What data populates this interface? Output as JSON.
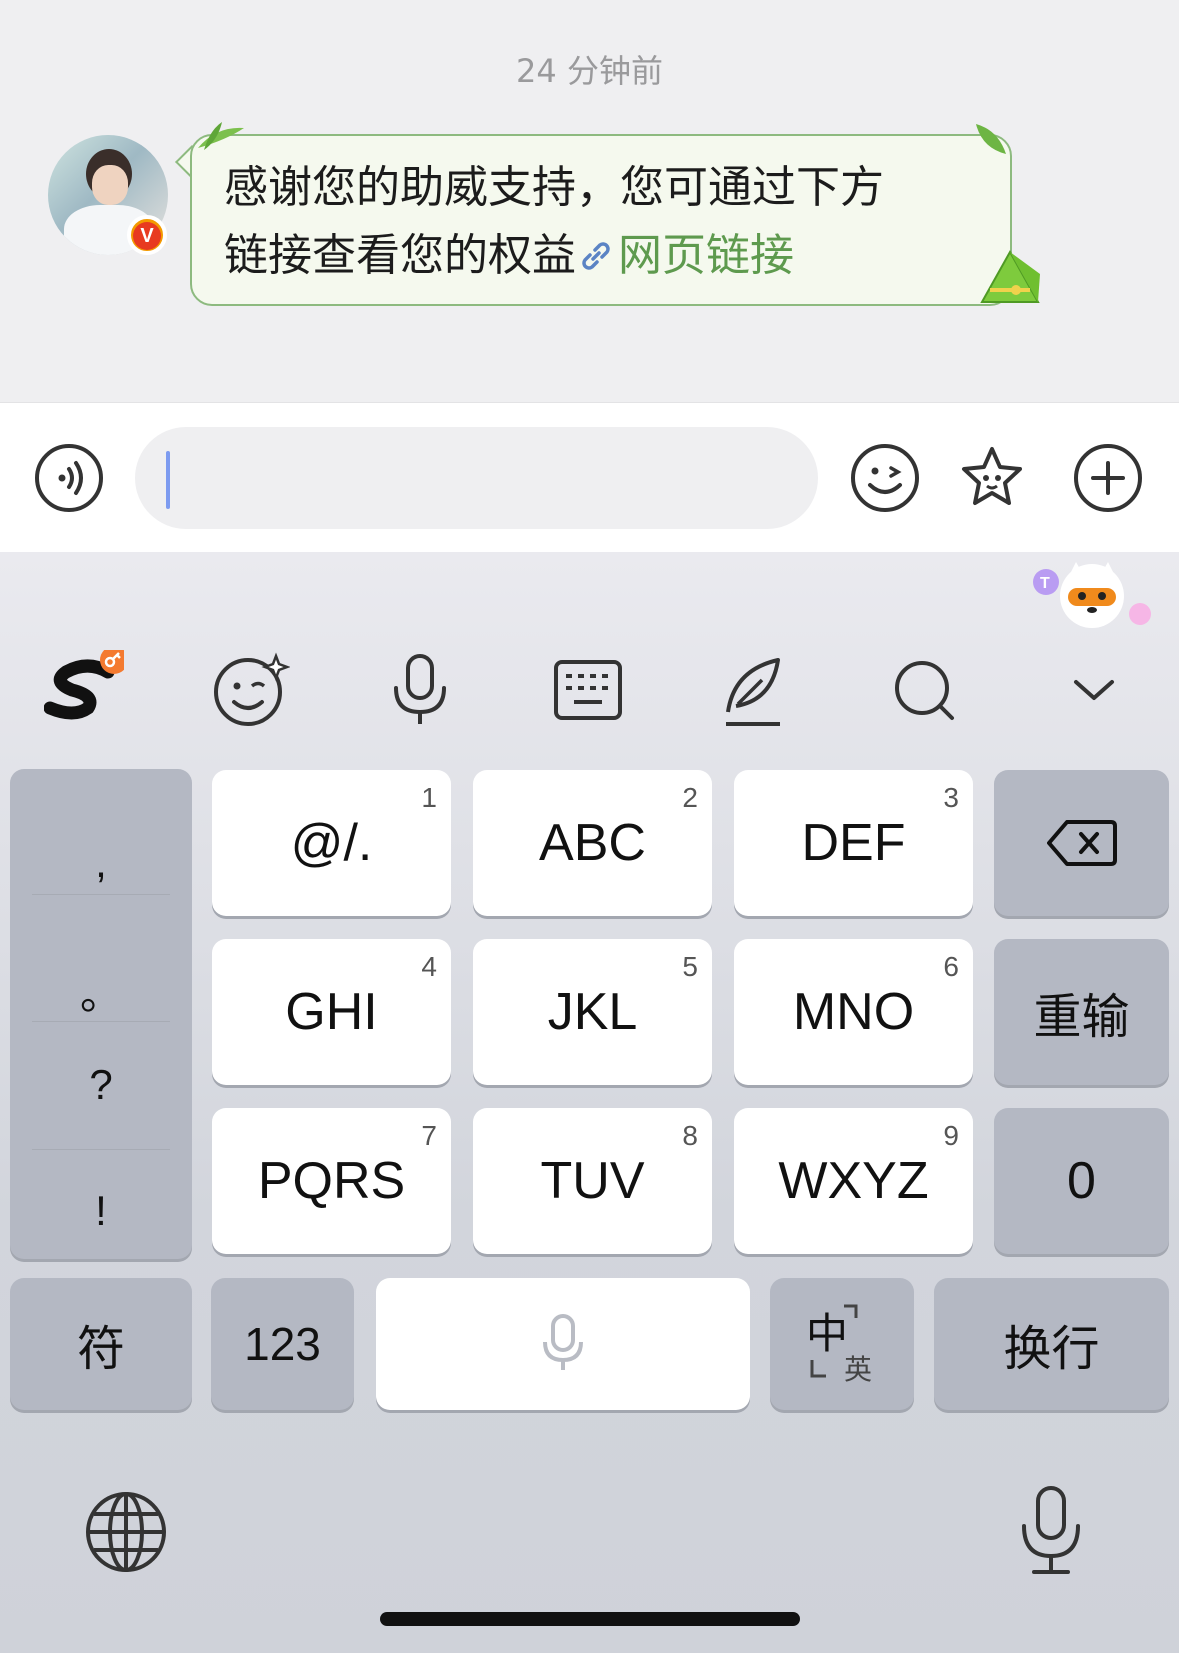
{
  "chat": {
    "timestamp": "24 分钟前",
    "message_line1": "感谢您的助威支持，您可通过下方",
    "message_line2": "链接查看您的权益",
    "link_text": "网页链接",
    "badge": "V"
  },
  "input": {
    "value": "",
    "voice_icon": "voice-wave-icon",
    "emoji_icon": "emoji-icon",
    "sticker_icon": "star-sticker-icon",
    "add_icon": "plus-icon"
  },
  "keyboard": {
    "toolbar": [
      "sogou-logo-icon",
      "emoji-wink-icon",
      "microphone-icon",
      "keyboard-icon",
      "handwriting-pen-icon",
      "search-icon",
      "chevron-down-icon"
    ],
    "punct": [
      ",",
      "。",
      "?",
      "!"
    ],
    "keys": [
      {
        "label": "@/.",
        "num": "1"
      },
      {
        "label": "ABC",
        "num": "2"
      },
      {
        "label": "DEF",
        "num": "3"
      },
      {
        "label": "GHI",
        "num": "4"
      },
      {
        "label": "JKL",
        "num": "5"
      },
      {
        "label": "MNO",
        "num": "6"
      },
      {
        "label": "PQRS",
        "num": "7"
      },
      {
        "label": "TUV",
        "num": "8"
      },
      {
        "label": "WXYZ",
        "num": "9"
      }
    ],
    "reinput": "重输",
    "zero": "0",
    "symbol": "符",
    "numbers": "123",
    "lang_main": "中",
    "lang_sub": "英",
    "enter": "换行",
    "colors": {
      "bubble_border": "#8dba7f",
      "link": "#5e9a4e",
      "caret": "#7d9bf0"
    }
  }
}
